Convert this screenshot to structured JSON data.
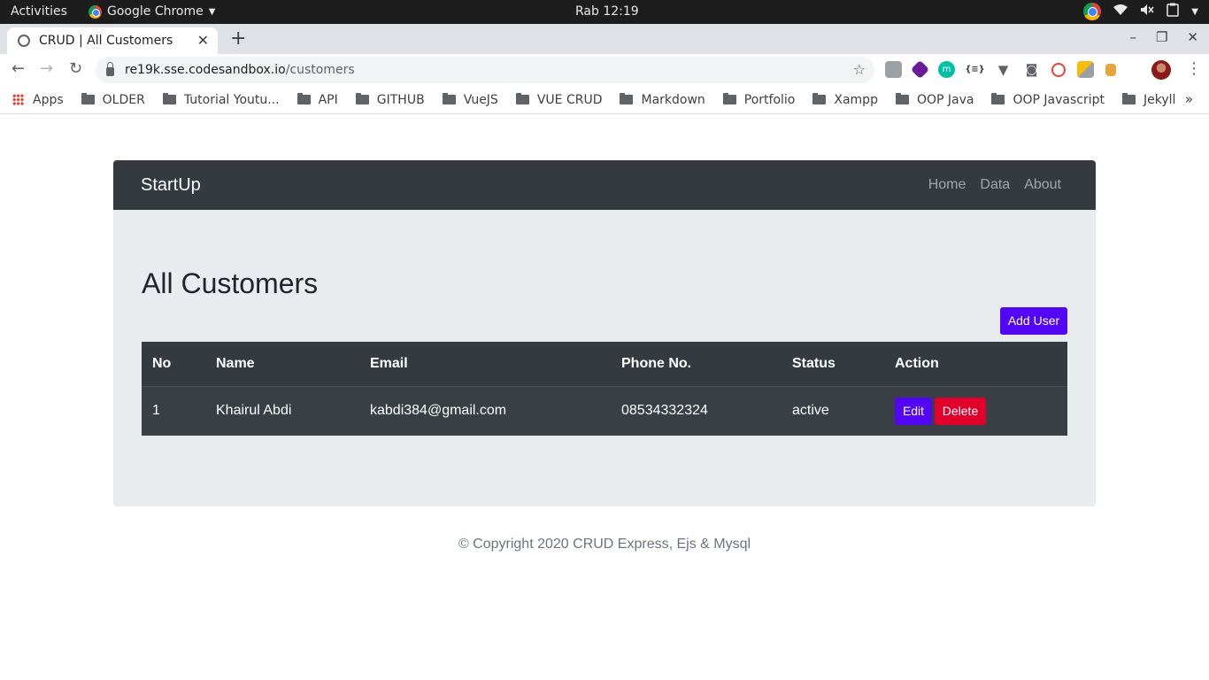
{
  "system_bar": {
    "activities": "Activities",
    "app_name": "Google Chrome",
    "clock": "Rab 12:19"
  },
  "browser": {
    "tab_title": "CRUD | All Customers",
    "url_host": "re19k.sse.codesandbox.io",
    "url_path": "/customers",
    "bookmarks": [
      "Apps",
      "OLDER",
      "Tutorial Youtu...",
      "API",
      "GITHUB",
      "VueJS",
      "VUE CRUD",
      "Markdown",
      "Portfolio",
      "Xampp",
      "OOP Java",
      "OOP Javascript",
      "Jekyll"
    ]
  },
  "navbar": {
    "brand": "StartUp",
    "links": [
      "Home",
      "Data",
      "About"
    ]
  },
  "main": {
    "title": "All Customers",
    "add_button": "Add User",
    "table": {
      "headers": [
        "No",
        "Name",
        "Email",
        "Phone No.",
        "Status",
        "Action"
      ],
      "rows": [
        {
          "no": "1",
          "name": "Khairul Abdi",
          "email": "kabdi384@gmail.com",
          "phone": "08534332324",
          "status": "active",
          "edit_label": "Edit",
          "delete_label": "Delete"
        }
      ]
    }
  },
  "footer": {
    "text": "© Copyright 2020 CRUD Express, Ejs & Mysql"
  },
  "colors": {
    "navbar_bg": "#343a40",
    "card_bg": "#e9ecef",
    "primary_button": "#5305f5",
    "danger_button": "#e0002a"
  }
}
